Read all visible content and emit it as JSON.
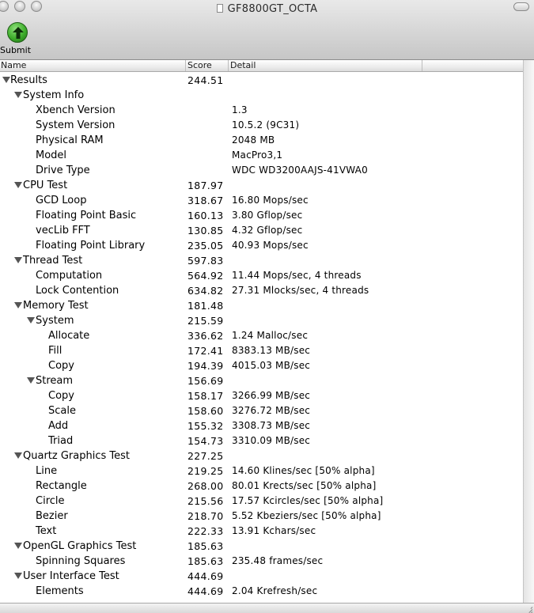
{
  "window": {
    "title": "GF8800GT_OCTA"
  },
  "toolbar": {
    "submit_label": "Submit"
  },
  "columns": {
    "name": "Name",
    "score": "Score",
    "detail": "Detail"
  },
  "rows": [
    {
      "name": "Results",
      "score": "244.51",
      "detail": "",
      "level": 0,
      "expandable": true
    },
    {
      "name": "System Info",
      "score": "",
      "detail": "",
      "level": 1,
      "expandable": true
    },
    {
      "name": "Xbench Version",
      "score": "",
      "detail": "1.3",
      "level": 2,
      "expandable": false
    },
    {
      "name": "System Version",
      "score": "",
      "detail": "10.5.2 (9C31)",
      "level": 2,
      "expandable": false
    },
    {
      "name": "Physical RAM",
      "score": "",
      "detail": "2048 MB",
      "level": 2,
      "expandable": false
    },
    {
      "name": "Model",
      "score": "",
      "detail": "MacPro3,1",
      "level": 2,
      "expandable": false
    },
    {
      "name": "Drive Type",
      "score": "",
      "detail": "WDC WD3200AAJS-41VWA0",
      "level": 2,
      "expandable": false
    },
    {
      "name": "CPU Test",
      "score": "187.97",
      "detail": "",
      "level": 1,
      "expandable": true
    },
    {
      "name": "GCD Loop",
      "score": "318.67",
      "detail": "16.80 Mops/sec",
      "level": 2,
      "expandable": false
    },
    {
      "name": "Floating Point Basic",
      "score": "160.13",
      "detail": "3.80 Gflop/sec",
      "level": 2,
      "expandable": false
    },
    {
      "name": "vecLib FFT",
      "score": "130.85",
      "detail": "4.32 Gflop/sec",
      "level": 2,
      "expandable": false
    },
    {
      "name": "Floating Point Library",
      "score": "235.05",
      "detail": "40.93 Mops/sec",
      "level": 2,
      "expandable": false
    },
    {
      "name": "Thread Test",
      "score": "597.83",
      "detail": "",
      "level": 1,
      "expandable": true
    },
    {
      "name": "Computation",
      "score": "564.92",
      "detail": "11.44 Mops/sec, 4 threads",
      "level": 2,
      "expandable": false
    },
    {
      "name": "Lock Contention",
      "score": "634.82",
      "detail": "27.31 Mlocks/sec, 4 threads",
      "level": 2,
      "expandable": false
    },
    {
      "name": "Memory Test",
      "score": "181.48",
      "detail": "",
      "level": 1,
      "expandable": true
    },
    {
      "name": "System",
      "score": "215.59",
      "detail": "",
      "level": 2,
      "expandable": true
    },
    {
      "name": "Allocate",
      "score": "336.62",
      "detail": "1.24 Malloc/sec",
      "level": 3,
      "expandable": false
    },
    {
      "name": "Fill",
      "score": "172.41",
      "detail": "8383.13 MB/sec",
      "level": 3,
      "expandable": false
    },
    {
      "name": "Copy",
      "score": "194.39",
      "detail": "4015.03 MB/sec",
      "level": 3,
      "expandable": false
    },
    {
      "name": "Stream",
      "score": "156.69",
      "detail": "",
      "level": 2,
      "expandable": true
    },
    {
      "name": "Copy",
      "score": "158.17",
      "detail": "3266.99 MB/sec",
      "level": 3,
      "expandable": false
    },
    {
      "name": "Scale",
      "score": "158.60",
      "detail": "3276.72 MB/sec",
      "level": 3,
      "expandable": false
    },
    {
      "name": "Add",
      "score": "155.32",
      "detail": "3308.73 MB/sec",
      "level": 3,
      "expandable": false
    },
    {
      "name": "Triad",
      "score": "154.73",
      "detail": "3310.09 MB/sec",
      "level": 3,
      "expandable": false
    },
    {
      "name": "Quartz Graphics Test",
      "score": "227.25",
      "detail": "",
      "level": 1,
      "expandable": true
    },
    {
      "name": "Line",
      "score": "219.25",
      "detail": "14.60 Klines/sec [50% alpha]",
      "level": 2,
      "expandable": false
    },
    {
      "name": "Rectangle",
      "score": "268.00",
      "detail": "80.01 Krects/sec [50% alpha]",
      "level": 2,
      "expandable": false
    },
    {
      "name": "Circle",
      "score": "215.56",
      "detail": "17.57 Kcircles/sec [50% alpha]",
      "level": 2,
      "expandable": false
    },
    {
      "name": "Bezier",
      "score": "218.70",
      "detail": "5.52 Kbeziers/sec [50% alpha]",
      "level": 2,
      "expandable": false
    },
    {
      "name": "Text",
      "score": "222.33",
      "detail": "13.91 Kchars/sec",
      "level": 2,
      "expandable": false
    },
    {
      "name": "OpenGL Graphics Test",
      "score": "185.63",
      "detail": "",
      "level": 1,
      "expandable": true
    },
    {
      "name": "Spinning Squares",
      "score": "185.63",
      "detail": "235.48 frames/sec",
      "level": 2,
      "expandable": false
    },
    {
      "name": "User Interface Test",
      "score": "444.69",
      "detail": "",
      "level": 1,
      "expandable": true
    },
    {
      "name": "Elements",
      "score": "444.69",
      "detail": "2.04 Krefresh/sec",
      "level": 2,
      "expandable": false
    }
  ]
}
